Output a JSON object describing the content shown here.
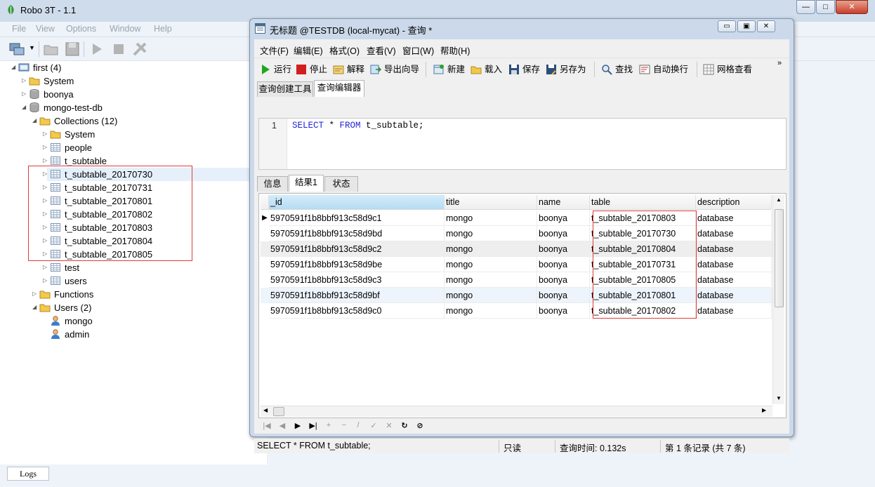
{
  "main_window": {
    "title": "Robo 3T - 1.1",
    "menu": [
      "File",
      "View",
      "Options",
      "Window",
      "Help"
    ],
    "window_buttons": {
      "minimize": "—",
      "maximize": "□",
      "close": "✕"
    }
  },
  "explorer": {
    "nodes": [
      {
        "label": "first (4)",
        "icon": "server-icon"
      },
      {
        "label": "System",
        "icon": "folder-icon"
      },
      {
        "label": "boonya",
        "icon": "database-icon"
      },
      {
        "label": "mongo-test-db",
        "icon": "database-icon"
      },
      {
        "label": "Collections (12)",
        "icon": "folder-icon"
      },
      {
        "label": "System",
        "icon": "folder-icon"
      },
      {
        "label": "people",
        "icon": "collection-icon"
      },
      {
        "label": "t_subtable",
        "icon": "collection-icon"
      },
      {
        "label": "t_subtable_20170730",
        "icon": "collection-icon"
      },
      {
        "label": "t_subtable_20170731",
        "icon": "collection-icon"
      },
      {
        "label": "t_subtable_20170801",
        "icon": "collection-icon"
      },
      {
        "label": "t_subtable_20170802",
        "icon": "collection-icon"
      },
      {
        "label": "t_subtable_20170803",
        "icon": "collection-icon"
      },
      {
        "label": "t_subtable_20170804",
        "icon": "collection-icon"
      },
      {
        "label": "t_subtable_20170805",
        "icon": "collection-icon"
      },
      {
        "label": "test",
        "icon": "collection-icon"
      },
      {
        "label": "users",
        "icon": "collection-icon"
      },
      {
        "label": "Functions",
        "icon": "folder-icon"
      },
      {
        "label": "Users (2)",
        "icon": "folder-icon"
      },
      {
        "label": "mongo",
        "icon": "user-icon"
      },
      {
        "label": "admin",
        "icon": "user-icon"
      }
    ]
  },
  "logs_tab": "Logs",
  "query_window": {
    "title": "无标题 @TESTDB (local-mycat) - 查询 *",
    "menu": [
      "文件(F)",
      "编辑(E)",
      "格式(O)",
      "查看(V)",
      "窗口(W)",
      "帮助(H)"
    ],
    "toolbar": {
      "run": "运行",
      "stop": "停止",
      "explain": "解释",
      "export": "导出向导",
      "new": "新建",
      "load": "载入",
      "save": "保存",
      "save_as": "另存为",
      "find": "查找",
      "wrap": "自动换行",
      "grid_view": "网格查看",
      "more": "»"
    },
    "editor_tabs": [
      "查询创建工具",
      "查询编辑器"
    ],
    "sql": {
      "line_number": "1",
      "kw1": "SELECT",
      "mid": " * ",
      "kw2": "FROM",
      "rest": " t_subtable;"
    },
    "result_tabs": [
      "信息",
      "结果1",
      "状态"
    ],
    "grid": {
      "columns": [
        "_id",
        "title",
        "name",
        "table",
        "description"
      ],
      "current_row_marker": "▶",
      "rows": [
        [
          "5970591f1b8bbf913c58d9c1",
          "mongo",
          "boonya",
          "t_subtable_20170803",
          "database"
        ],
        [
          "5970591f1b8bbf913c58d9bd",
          "mongo",
          "boonya",
          "t_subtable_20170730",
          "database"
        ],
        [
          "5970591f1b8bbf913c58d9c2",
          "mongo",
          "boonya",
          "t_subtable_20170804",
          "database"
        ],
        [
          "5970591f1b8bbf913c58d9be",
          "mongo",
          "boonya",
          "t_subtable_20170731",
          "database"
        ],
        [
          "5970591f1b8bbf913c58d9c3",
          "mongo",
          "boonya",
          "t_subtable_20170805",
          "database"
        ],
        [
          "5970591f1b8bbf913c58d9bf",
          "mongo",
          "boonya",
          "t_subtable_20170801",
          "database"
        ],
        [
          "5970591f1b8bbf913c58d9c0",
          "mongo",
          "boonya",
          "t_subtable_20170802",
          "database"
        ]
      ]
    },
    "nav_buttons": [
      "|◀",
      "◀",
      "▶",
      "▶|",
      "+",
      "−",
      "/",
      "✓",
      "✕",
      "↻",
      "⊘"
    ],
    "status": {
      "sql": "SELECT * FROM t_subtable;",
      "mode": "只读",
      "time": "查询时间: 0.132s",
      "records": "第 1 条记录 (共 7 条)"
    }
  },
  "colors": {
    "highlight_box": "#e03a3a",
    "selected_header": "#b6dcf3",
    "keyword": "#2424d6"
  }
}
